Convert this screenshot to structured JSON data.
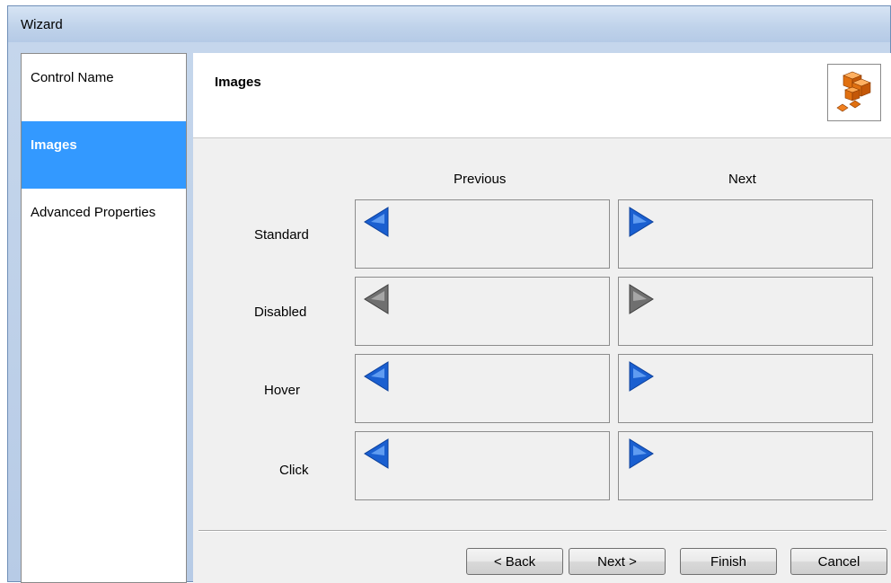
{
  "window": {
    "title": "Wizard"
  },
  "sidebar": {
    "items": [
      {
        "label": "Control Name",
        "active": false
      },
      {
        "label": "Images",
        "active": true
      },
      {
        "label": "Advanced Properties",
        "active": false
      }
    ]
  },
  "header": {
    "title": "Images",
    "logo_icon": "orange-cubes-icon"
  },
  "grid": {
    "columns": [
      "Previous",
      "Next"
    ],
    "rows": [
      "Standard",
      "Disabled",
      "Hover",
      "Click"
    ],
    "colors": {
      "enabled": "#1a5fd0",
      "disabled": "#6f6f6f"
    }
  },
  "buttons": {
    "back": "< Back",
    "next": "Next >",
    "finish": "Finish",
    "cancel": "Cancel"
  }
}
